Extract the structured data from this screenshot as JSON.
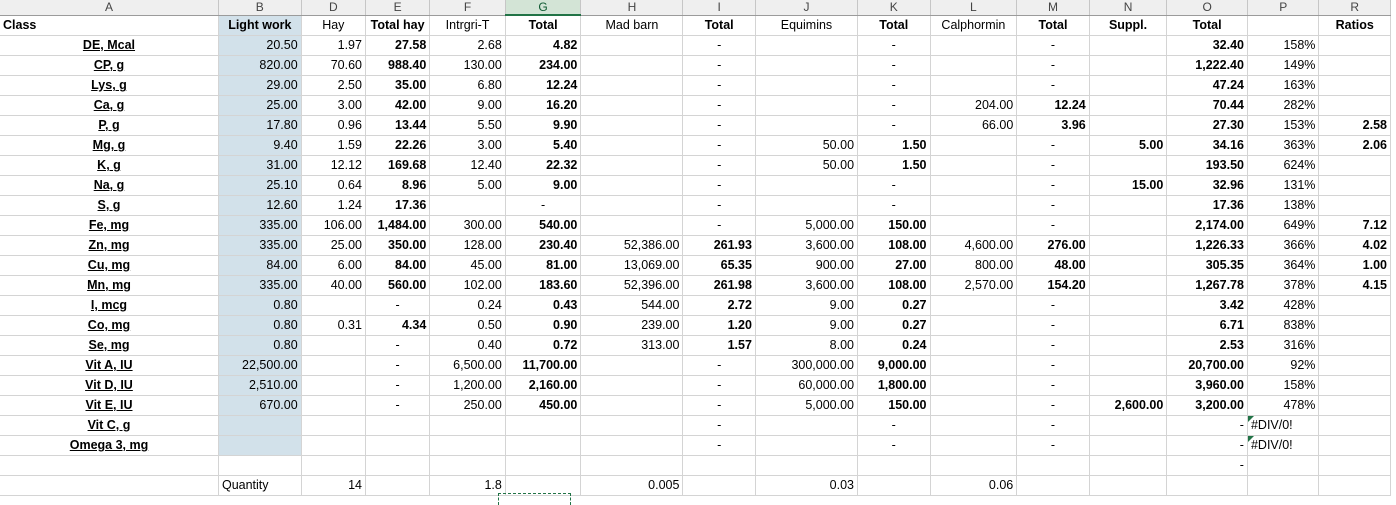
{
  "columns": [
    "A",
    "B",
    "D",
    "E",
    "F",
    "G",
    "H",
    "I",
    "J",
    "K",
    "L",
    "M",
    "N",
    "O",
    "P",
    "R"
  ],
  "selected_column": "G",
  "header_row": [
    "Class",
    "Light work",
    "Hay",
    "Total hay",
    "Intrgri-T",
    "Total",
    "Mad barn",
    "Total",
    "Equimins",
    "Total",
    "Calphormin",
    "Total",
    "Suppl.",
    "Total",
    "",
    "Ratios"
  ],
  "rows": [
    [
      "DE, Mcal",
      "20.50",
      "1.97",
      "27.58",
      "2.68",
      "4.82",
      "",
      "-",
      "",
      "-",
      "",
      "-",
      "",
      "32.40",
      "158%",
      ""
    ],
    [
      "CP, g",
      "820.00",
      "70.60",
      "988.40",
      "130.00",
      "234.00",
      "",
      "-",
      "",
      "-",
      "",
      "-",
      "",
      "1,222.40",
      "149%",
      ""
    ],
    [
      "Lys, g",
      "29.00",
      "2.50",
      "35.00",
      "6.80",
      "12.24",
      "",
      "-",
      "",
      "-",
      "",
      "-",
      "",
      "47.24",
      "163%",
      ""
    ],
    [
      "Ca, g",
      "25.00",
      "3.00",
      "42.00",
      "9.00",
      "16.20",
      "",
      "-",
      "",
      "-",
      "204.00",
      "12.24",
      "",
      "70.44",
      "282%",
      ""
    ],
    [
      "P, g",
      "17.80",
      "0.96",
      "13.44",
      "5.50",
      "9.90",
      "",
      "-",
      "",
      "-",
      "66.00",
      "3.96",
      "",
      "27.30",
      "153%",
      "2.58"
    ],
    [
      "Mg, g",
      "9.40",
      "1.59",
      "22.26",
      "3.00",
      "5.40",
      "",
      "-",
      "50.00",
      "1.50",
      "",
      "-",
      "5.00",
      "34.16",
      "363%",
      "2.06"
    ],
    [
      "K, g",
      "31.00",
      "12.12",
      "169.68",
      "12.40",
      "22.32",
      "",
      "-",
      "50.00",
      "1.50",
      "",
      "-",
      "",
      "193.50",
      "624%",
      ""
    ],
    [
      "Na, g",
      "25.10",
      "0.64",
      "8.96",
      "5.00",
      "9.00",
      "",
      "-",
      "",
      "-",
      "",
      "-",
      "15.00",
      "32.96",
      "131%",
      ""
    ],
    [
      "S, g",
      "12.60",
      "1.24",
      "17.36",
      "",
      "-",
      "",
      "-",
      "",
      "-",
      "",
      "-",
      "",
      "17.36",
      "138%",
      ""
    ],
    [
      "Fe, mg",
      "335.00",
      "106.00",
      "1,484.00",
      "300.00",
      "540.00",
      "",
      "-",
      "5,000.00",
      "150.00",
      "",
      "-",
      "",
      "2,174.00",
      "649%",
      "7.12"
    ],
    [
      "Zn, mg",
      "335.00",
      "25.00",
      "350.00",
      "128.00",
      "230.40",
      "52,386.00",
      "261.93",
      "3,600.00",
      "108.00",
      "4,600.00",
      "276.00",
      "",
      "1,226.33",
      "366%",
      "4.02"
    ],
    [
      "Cu, mg",
      "84.00",
      "6.00",
      "84.00",
      "45.00",
      "81.00",
      "13,069.00",
      "65.35",
      "900.00",
      "27.00",
      "800.00",
      "48.00",
      "",
      "305.35",
      "364%",
      "1.00"
    ],
    [
      "Mn, mg",
      "335.00",
      "40.00",
      "560.00",
      "102.00",
      "183.60",
      "52,396.00",
      "261.98",
      "3,600.00",
      "108.00",
      "2,570.00",
      "154.20",
      "",
      "1,267.78",
      "378%",
      "4.15"
    ],
    [
      "I, mcg",
      "0.80",
      "",
      "-",
      "0.24",
      "0.43",
      "544.00",
      "2.72",
      "9.00",
      "0.27",
      "",
      "-",
      "",
      "3.42",
      "428%",
      ""
    ],
    [
      "Co, mg",
      "0.80",
      "0.31",
      "4.34",
      "0.50",
      "0.90",
      "239.00",
      "1.20",
      "9.00",
      "0.27",
      "",
      "-",
      "",
      "6.71",
      "838%",
      ""
    ],
    [
      "Se, mg",
      "0.80",
      "",
      "-",
      "0.40",
      "0.72",
      "313.00",
      "1.57",
      "8.00",
      "0.24",
      "",
      "-",
      "",
      "2.53",
      "316%",
      ""
    ],
    [
      "Vit A, IU",
      "22,500.00",
      "",
      "-",
      "6,500.00",
      "11,700.00",
      "",
      "-",
      "300,000.00",
      "9,000.00",
      "",
      "-",
      "",
      "20,700.00",
      "92%",
      ""
    ],
    [
      "Vit D, IU",
      "2,510.00",
      "",
      "-",
      "1,200.00",
      "2,160.00",
      "",
      "-",
      "60,000.00",
      "1,800.00",
      "",
      "-",
      "",
      "3,960.00",
      "158%",
      ""
    ],
    [
      "Vit E, IU",
      "670.00",
      "",
      "-",
      "250.00",
      "450.00",
      "",
      "-",
      "5,000.00",
      "150.00",
      "",
      "-",
      "2,600.00",
      "3,200.00",
      "478%",
      ""
    ],
    [
      "Vit C, g",
      "",
      "",
      "",
      "",
      "",
      "",
      "-",
      "",
      "-",
      "",
      "-",
      "",
      "-",
      "#DIV/0!",
      ""
    ],
    [
      "Omega 3, mg",
      "",
      "",
      "",
      "",
      "",
      "",
      "-",
      "",
      "-",
      "",
      "-",
      "",
      "-",
      "#DIV/0!",
      ""
    ],
    [
      "",
      "",
      "",
      "",
      "",
      "",
      "",
      "",
      "",
      "",
      "",
      "",
      "",
      "-",
      "",
      ""
    ],
    [
      "",
      "Quantity",
      "14",
      "",
      "1.8",
      "",
      "0.005",
      "",
      "0.03",
      "",
      "0.06",
      "",
      "",
      "",
      "",
      ""
    ]
  ]
}
